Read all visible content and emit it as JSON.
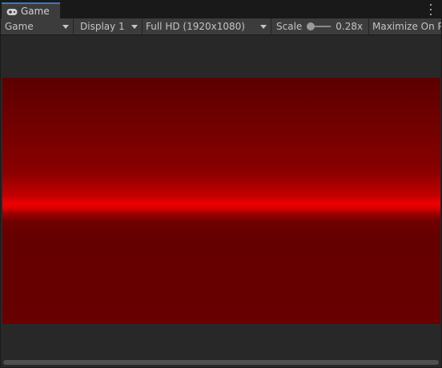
{
  "tab": {
    "title": "Game",
    "icon": "gamepad-icon"
  },
  "toolbar": {
    "view_mode": "Game",
    "display": "Display 1",
    "resolution": "Full HD (1920x1080)",
    "scale_label": "Scale",
    "scale_value": "0.28x",
    "maximize_label": "Maximize On P"
  },
  "colors": {
    "tab_accent": "#3a79bb",
    "panel_bg": "#282828",
    "toolbar_bg": "#3c3c3c",
    "game_red": "#ee0000",
    "game_dark_red": "#670000"
  }
}
